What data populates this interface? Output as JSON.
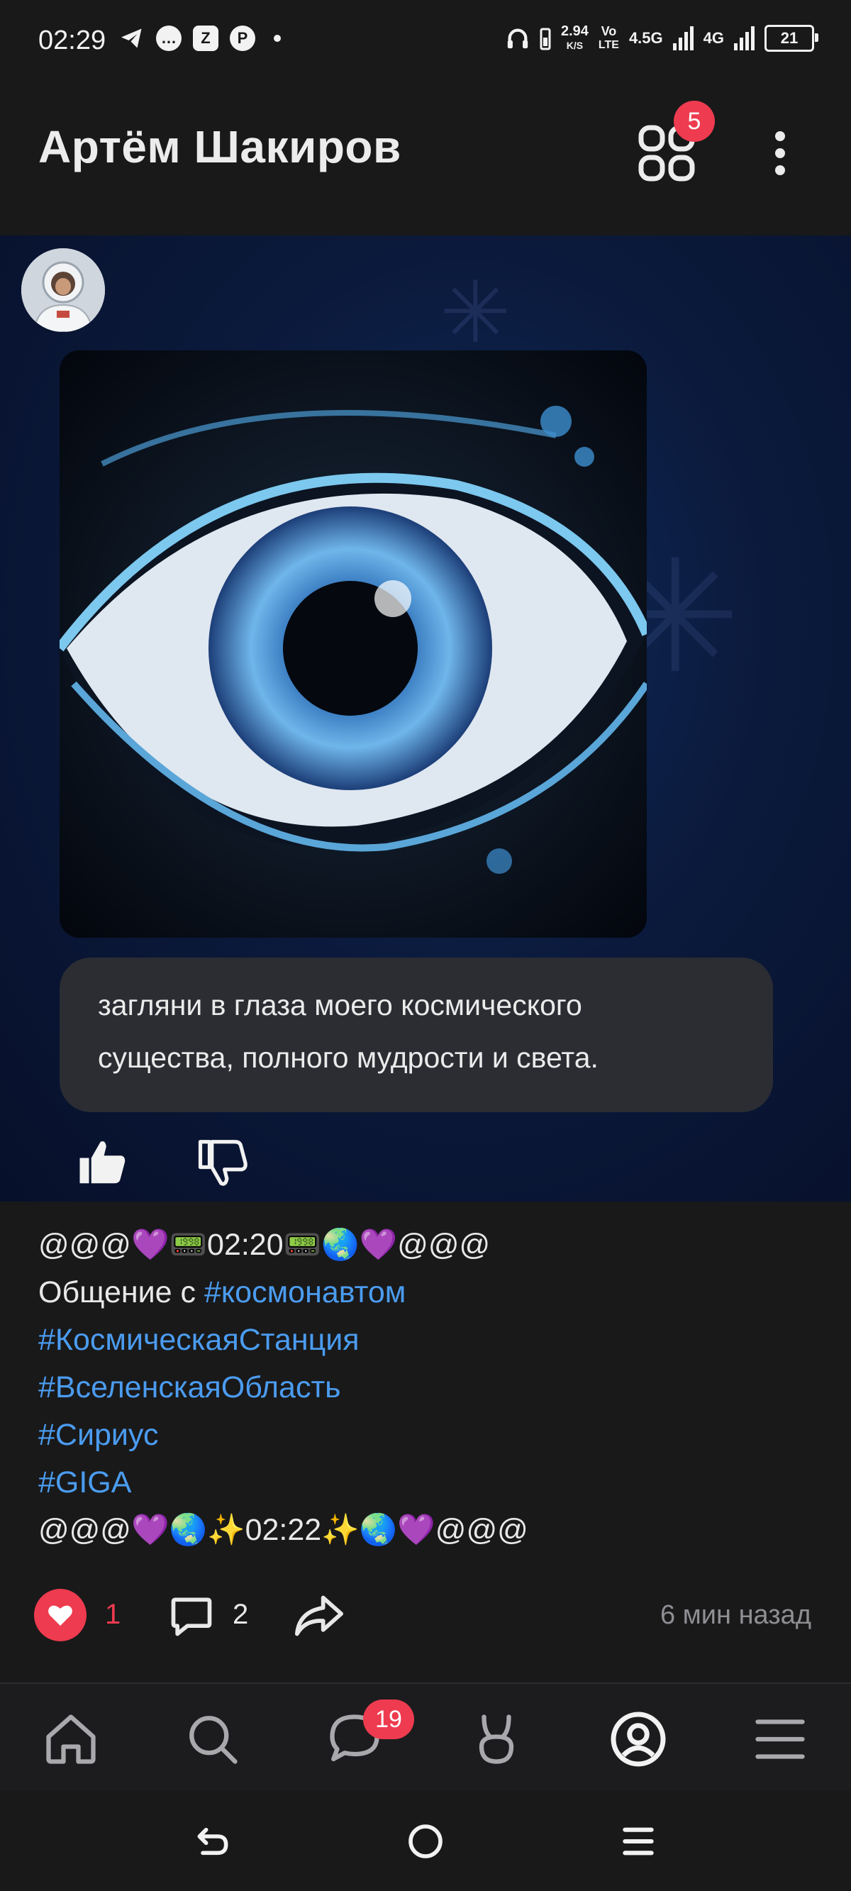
{
  "status_bar": {
    "time": "02:29",
    "app_icons": [
      "telegram-icon",
      "message-icon",
      "z-app-icon",
      "pinterest-icon"
    ],
    "net_speed_value": "2.94",
    "net_speed_unit": "K/S",
    "volte_top": "Vo",
    "volte_bottom": "LTE",
    "net1": "4.5G",
    "net2": "4G",
    "battery": "21"
  },
  "header": {
    "title": "Артём Шакиров",
    "apps_badge": "5"
  },
  "story": {
    "caption": " загляни в глаза моего космического\nсущества, полного мудрости и света."
  },
  "post": {
    "line1": "@@@💜📟02:20📟🌏💜@@@",
    "line2_text": "Общение с ",
    "line2_tag": "#космонавтом",
    "tag1": "#КосмическаяСтанция",
    "tag2": "#ВселенскаяОбласть",
    "tag3": "#Сириус",
    "tag4": "#GIGA",
    "line_last": "@@@💜🌏✨02:22✨🌏💜@@@"
  },
  "actions": {
    "likes": "1",
    "comments": "2",
    "time_ago": "6 мин назад"
  },
  "bottom_nav": {
    "messages_badge": "19"
  },
  "colors": {
    "background": "#19191a",
    "accent_red": "#ee3b4f",
    "hashtag_blue": "#4b9cf0",
    "caption_bubble": "#2b2d33"
  }
}
